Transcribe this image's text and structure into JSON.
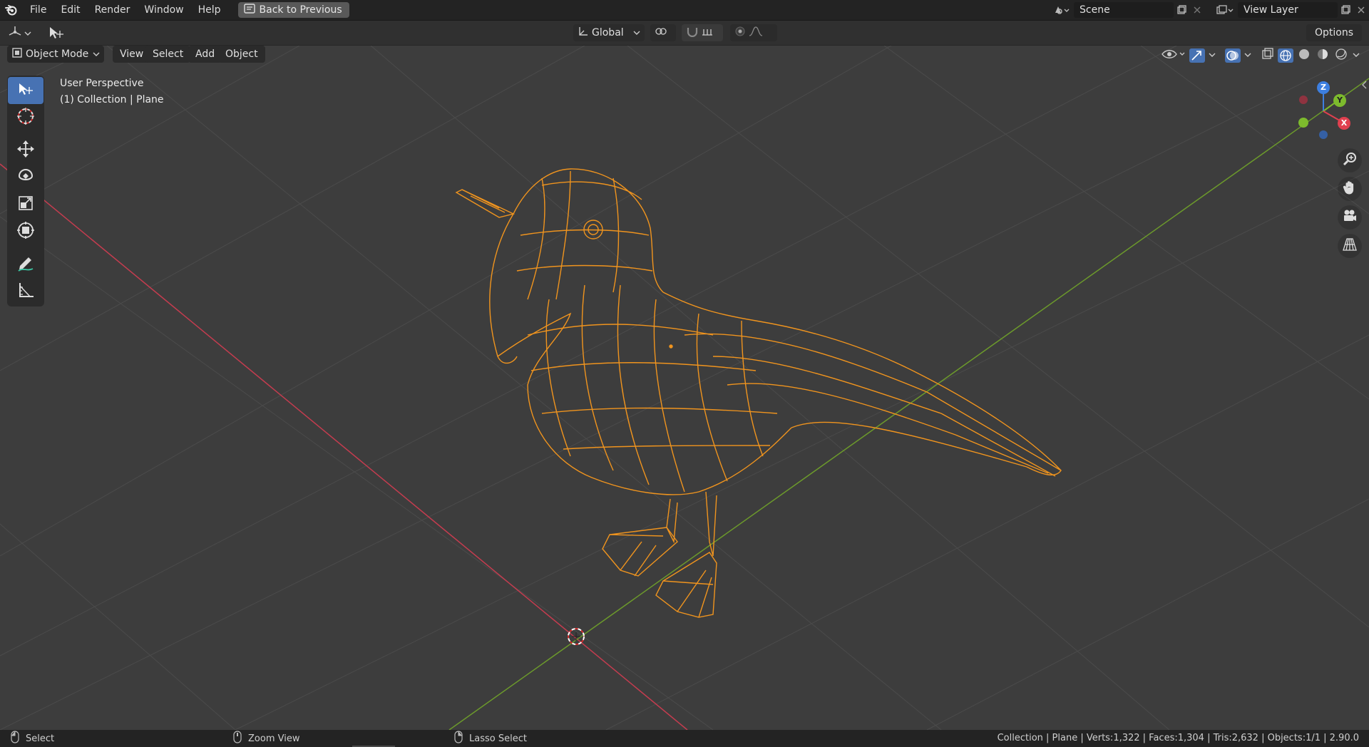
{
  "menu": {
    "items": [
      "File",
      "Edit",
      "Render",
      "Window",
      "Help"
    ],
    "back_button": "Back to Previous"
  },
  "scene": {
    "value": "Scene",
    "view_layer": "View Layer"
  },
  "header": {
    "transform_orientation": "Global",
    "options": "Options"
  },
  "view3d_header": {
    "mode": "Object Mode",
    "menus": [
      "View",
      "Select",
      "Add",
      "Object"
    ]
  },
  "viewport": {
    "perspective": "User Perspective",
    "collection": "(1) Collection | Plane"
  },
  "gizmo": {
    "z": "Z",
    "y": "Y",
    "x": "X"
  },
  "status": {
    "select": "Select",
    "zoom": "Zoom View",
    "lasso": "Lasso Select",
    "stats": "Collection | Plane | Verts:1,322 | Faces:1,304 | Tris:2,632 | Objects:1/1 | 2.90.0"
  },
  "colors": {
    "background": "#3d3d3d",
    "accent": "#4772b3",
    "wire_selected": "#f0941e",
    "x_axis": "#c53c4f",
    "y_axis": "#6c9a2b"
  }
}
